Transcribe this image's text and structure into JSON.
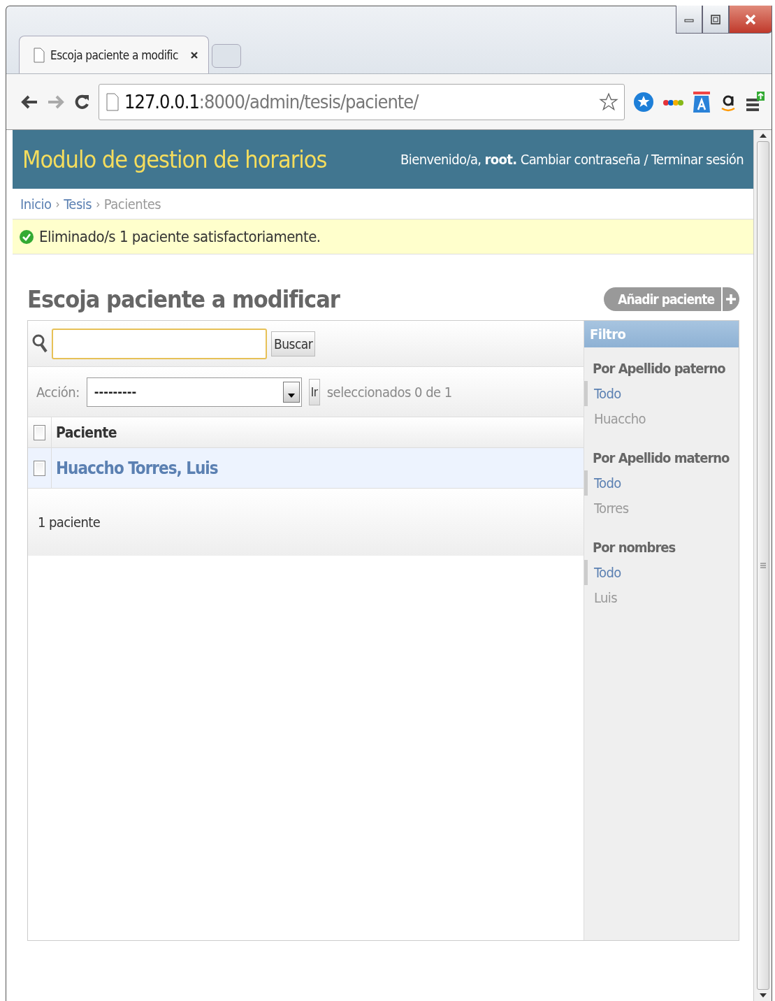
{
  "browser": {
    "tab_title": "Escoja paciente a modific",
    "url_host": "127.0.0.1",
    "url_path": ":8000/admin/tesis/paciente/"
  },
  "header": {
    "site_title": "Modulo de gestion de horarios",
    "welcome": "Bienvenido/a,",
    "user": "root.",
    "links": [
      {
        "label": "Cambiar contraseña"
      },
      {
        "label": "Terminar sesión"
      }
    ],
    "separator": "/"
  },
  "breadcrumbs": [
    {
      "label": "Inicio",
      "link": true
    },
    {
      "label": "Tesis",
      "link": true
    },
    {
      "label": "Pacientes",
      "link": false
    }
  ],
  "breadcrumb_separator": "›",
  "message": {
    "kind": "success",
    "text": "Eliminado/s 1 paciente satisfactoriamente."
  },
  "title": "Escoja paciente a modificar",
  "add_button": "Añadir paciente",
  "search": {
    "button": "Buscar"
  },
  "actions": {
    "label": "Acción:",
    "value": "---------",
    "go": "Ir",
    "counter": "seleccionados 0 de 1"
  },
  "table": {
    "columns": [
      "Paciente"
    ],
    "header_checked": false,
    "rows": [
      {
        "name": "Huaccho Torres, Luis",
        "checked": false
      }
    ]
  },
  "result_count": "1 paciente",
  "filter": {
    "title": "Filtro",
    "groups": [
      {
        "title": "Por Apellido paterno",
        "options": [
          {
            "label": "Todo",
            "selected": true
          },
          {
            "label": "Huaccho",
            "selected": false
          }
        ]
      },
      {
        "title": "Por Apellido materno",
        "options": [
          {
            "label": "Todo",
            "selected": true
          },
          {
            "label": "Torres",
            "selected": false
          }
        ]
      },
      {
        "title": "Por nombres",
        "options": [
          {
            "label": "Todo",
            "selected": true
          },
          {
            "label": "Luis",
            "selected": false
          }
        ]
      }
    ]
  }
}
